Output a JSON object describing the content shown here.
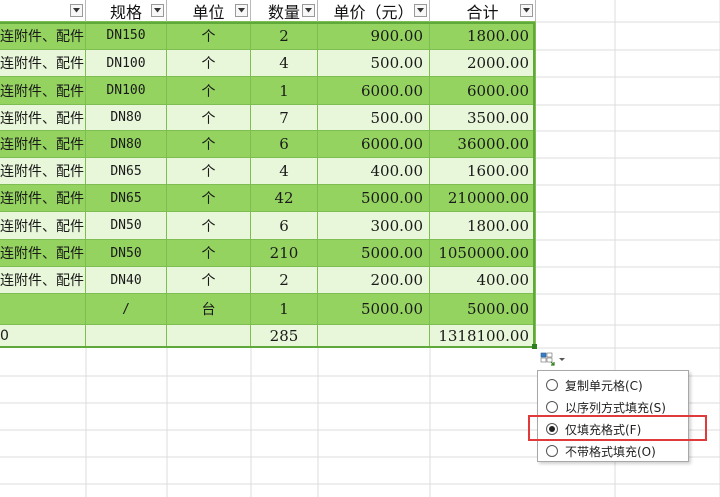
{
  "headers": [
    {
      "label": ""
    },
    {
      "label": "规格"
    },
    {
      "label": "单位"
    },
    {
      "label": "数量"
    },
    {
      "label": "单价（元）"
    },
    {
      "label": "合计"
    }
  ],
  "rows": [
    {
      "name": "连附件、配件",
      "spec": "DN150",
      "unit": "个",
      "qty": "2",
      "price": "900.00",
      "total": "1800.00"
    },
    {
      "name": "连附件、配件",
      "spec": "DN100",
      "unit": "个",
      "qty": "4",
      "price": "500.00",
      "total": "2000.00"
    },
    {
      "name": "连附件、配件",
      "spec": "DN100",
      "unit": "个",
      "qty": "1",
      "price": "6000.00",
      "total": "6000.00"
    },
    {
      "name": "连附件、配件",
      "spec": "DN80",
      "unit": "个",
      "qty": "7",
      "price": "500.00",
      "total": "3500.00"
    },
    {
      "name": "连附件、配件",
      "spec": "DN80",
      "unit": "个",
      "qty": "6",
      "price": "6000.00",
      "total": "36000.00"
    },
    {
      "name": "连附件、配件",
      "spec": "DN65",
      "unit": "个",
      "qty": "4",
      "price": "400.00",
      "total": "1600.00"
    },
    {
      "name": "连附件、配件",
      "spec": "DN65",
      "unit": "个",
      "qty": "42",
      "price": "5000.00",
      "total": "210000.00"
    },
    {
      "name": "连附件、配件",
      "spec": "DN50",
      "unit": "个",
      "qty": "6",
      "price": "300.00",
      "total": "1800.00"
    },
    {
      "name": "连附件、配件",
      "spec": "DN50",
      "unit": "个",
      "qty": "210",
      "price": "5000.00",
      "total": "1050000.00"
    },
    {
      "name": "连附件、配件",
      "spec": "DN40",
      "unit": "个",
      "qty": "2",
      "price": "200.00",
      "total": "400.00"
    },
    {
      "name": "",
      "spec": "/",
      "unit": "台",
      "qty": "1",
      "price": "5000.00",
      "total": "5000.00"
    }
  ],
  "summary": {
    "name": "0",
    "spec": "",
    "unit": "",
    "qty": "285",
    "price": "",
    "total": "1318100.00"
  },
  "autofill_menu": {
    "items": [
      {
        "label": "复制单元格(C)",
        "selected": false
      },
      {
        "label": "以序列方式填充(S)",
        "selected": false
      },
      {
        "label": "仅填充格式(F)",
        "selected": true
      },
      {
        "label": "不带格式填充(O)",
        "selected": false
      }
    ]
  },
  "colors": {
    "row_dark": "#94d360",
    "row_light": "#e8f6d9",
    "table_border": "#5fa83a",
    "highlight_box": "#e03a3a"
  },
  "icons": {
    "filter": "filter-dropdown-icon",
    "autofill": "autofill-options-icon"
  }
}
